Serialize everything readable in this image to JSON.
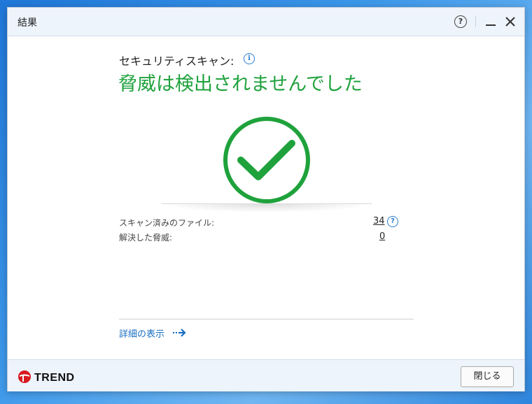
{
  "window": {
    "title": "結果",
    "help_label": "?"
  },
  "scan": {
    "label": "セキュリティスキャン:",
    "info_icon": "i",
    "result": "脅威は検出されませんでした",
    "status_color": "#1fa23c"
  },
  "stats": {
    "files_label": "スキャン済みのファイル:",
    "files_value": "34",
    "files_help": "?",
    "threats_label": "解決した脅威:",
    "threats_value": "0"
  },
  "details": {
    "link_label": "詳細の表示"
  },
  "footer": {
    "brand": "TREND",
    "brand_color": "#d71920",
    "close_label": "閉じる"
  },
  "icons": [
    "help-icon",
    "minimize-icon",
    "close-icon",
    "info-icon",
    "checkmark-icon",
    "arrow-right-icon",
    "trend-logo-icon"
  ]
}
